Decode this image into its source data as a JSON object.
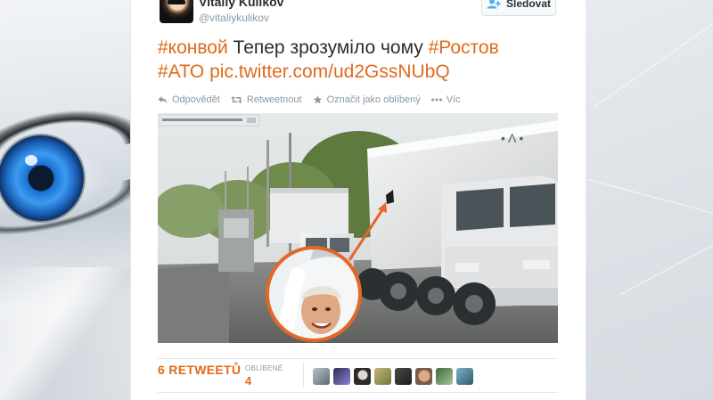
{
  "tweet": {
    "author_name": "Vitaliy Kulikov",
    "author_handle": "@vitaliykulikov",
    "follow_label": "Sledovat",
    "text": {
      "tag1": "#конвой",
      "middle": " Тепер зрозуміло чому ",
      "tag2": "#Ростов",
      "tag3": "#АТО",
      "link": "pic.twitter.com/ud2GssNUbQ"
    },
    "actions": {
      "reply": "Odpovědět",
      "retweet": "Retweetnout",
      "favorite": "Označit jako oblíbený",
      "more": "Víc"
    },
    "stats": {
      "retweets_number": "6",
      "retweets_label": "RETWEETŮ",
      "favorites_label": "OBLÍBENÉ",
      "favorites_number": "4"
    }
  },
  "colors": {
    "accent": "#e06a1a",
    "muted": "#8899a6",
    "text": "#292f33"
  },
  "icons": {
    "follow": "add-user-icon",
    "reply": "reply-icon",
    "retweet": "retweet-icon",
    "favorite": "star-icon",
    "more": "more-dots-icon"
  }
}
